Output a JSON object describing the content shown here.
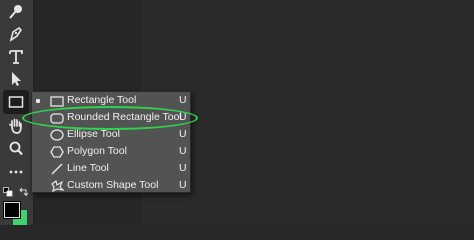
{
  "toolbar": {
    "tools": [
      {
        "name": "Eyedropper",
        "icon": "eyedropper-icon"
      },
      {
        "name": "Pen",
        "icon": "pen-icon"
      },
      {
        "name": "Type",
        "icon": "type-icon",
        "glyph": "T"
      },
      {
        "name": "Path Selection",
        "icon": "arrow-icon"
      },
      {
        "name": "Rectangle",
        "icon": "rectangle-icon",
        "active": true
      },
      {
        "name": "Hand",
        "icon": "hand-icon"
      },
      {
        "name": "Zoom",
        "icon": "zoom-icon"
      },
      {
        "name": "More",
        "icon": "more-icon",
        "glyph": "•••"
      }
    ],
    "foreground_color": "#000000",
    "background_color": "#3bd36a"
  },
  "flyout": {
    "items": [
      {
        "label": "Rectangle Tool",
        "shortcut": "U",
        "icon": "rectangle-icon",
        "selected": true
      },
      {
        "label": "Rounded Rectangle Tool",
        "shortcut": "U",
        "icon": "rounded-rectangle-icon",
        "highlighted": true
      },
      {
        "label": "Ellipse Tool",
        "shortcut": "U",
        "icon": "ellipse-icon"
      },
      {
        "label": "Polygon Tool",
        "shortcut": "U",
        "icon": "polygon-icon"
      },
      {
        "label": "Line Tool",
        "shortcut": "U",
        "icon": "line-icon"
      },
      {
        "label": "Custom Shape Tool",
        "shortcut": "U",
        "icon": "custom-shape-icon"
      }
    ],
    "highlight_color": "#2fd34b"
  }
}
